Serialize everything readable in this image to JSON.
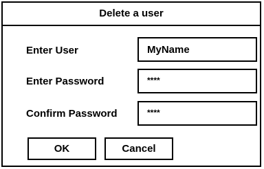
{
  "dialog": {
    "title": "Delete a user"
  },
  "form": {
    "user_label": "Enter User",
    "user_value": "MyName",
    "password_label": "Enter Password",
    "password_value": "****",
    "confirm_label": "Confirm Password",
    "confirm_value": "****"
  },
  "buttons": {
    "ok_label": "OK",
    "cancel_label": "Cancel"
  }
}
